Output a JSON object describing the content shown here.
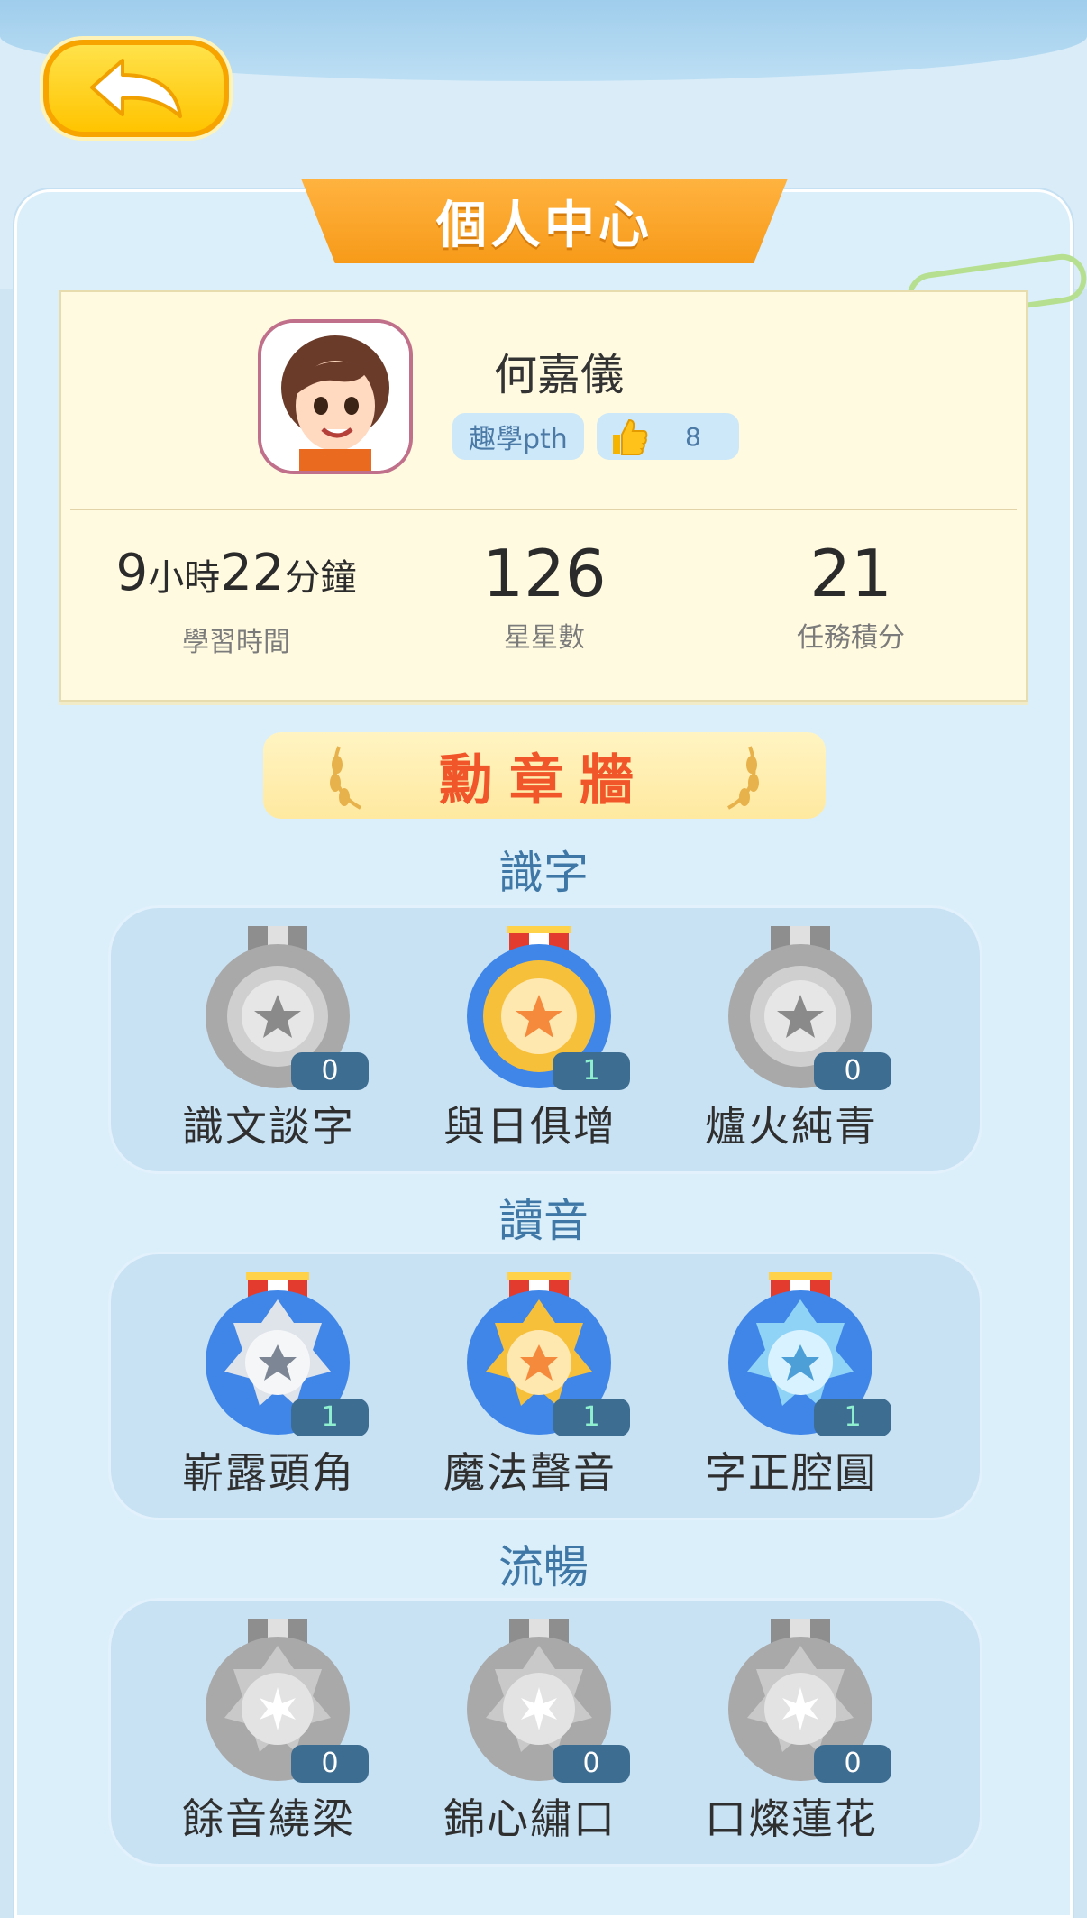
{
  "header": {
    "title": "個人中心"
  },
  "profile": {
    "name": "何嘉儀",
    "school_tag": "趣學pth",
    "likes": "8"
  },
  "stats": [
    {
      "value_hours": "9",
      "unit_hours": "小時",
      "value_minutes": "22",
      "unit_minutes": "分鐘",
      "label": "學習時間"
    },
    {
      "value": "126",
      "label": "星星數"
    },
    {
      "value": "21",
      "label": "任務積分"
    }
  ],
  "medal_wall": {
    "title": "勳章牆",
    "sections": [
      {
        "title": "識字",
        "medals": [
          {
            "name": "識文談字",
            "count": "0",
            "style": "grey"
          },
          {
            "name": "與日俱增",
            "count": "1",
            "style": "gold"
          },
          {
            "name": "爐火純青",
            "count": "0",
            "style": "grey"
          }
        ]
      },
      {
        "title": "讀音",
        "medals": [
          {
            "name": "嶄露頭角",
            "count": "1",
            "style": "silver-blue"
          },
          {
            "name": "魔法聲音",
            "count": "1",
            "style": "gold-blue"
          },
          {
            "name": "字正腔圓",
            "count": "1",
            "style": "cyan-blue"
          }
        ]
      },
      {
        "title": "流暢",
        "medals": [
          {
            "name": "餘音繞梁",
            "count": "0",
            "style": "grey"
          },
          {
            "name": "錦心繡口",
            "count": "0",
            "style": "grey"
          },
          {
            "name": "口燦蓮花",
            "count": "0",
            "style": "grey"
          }
        ]
      }
    ]
  },
  "colors": {
    "accent": "#f79a19",
    "section_title": "#3f78a6",
    "medal_wall_title": "#f1552a"
  }
}
